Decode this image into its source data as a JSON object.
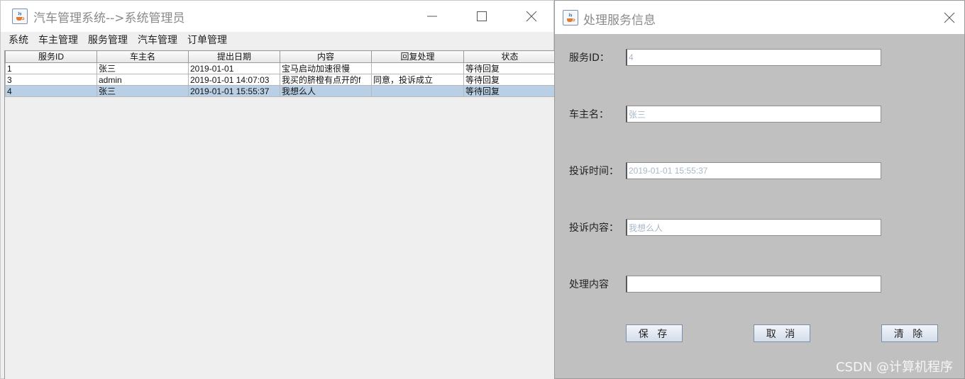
{
  "main_window": {
    "title": "汽车管理系统-->系统管理员",
    "menu": [
      "系统",
      "车主管理",
      "服务管理",
      "汽车管理",
      "订单管理"
    ],
    "table": {
      "columns": [
        "服务ID",
        "车主名",
        "提出日期",
        "内容",
        "回复处理",
        "状态"
      ],
      "rows": [
        [
          "1",
          "张三",
          "2019-01-01",
          "宝马启动加速很慢",
          "",
          "等待回复"
        ],
        [
          "3",
          "admin",
          "2019-01-01 14:07:03",
          "我买的脐橙有点开的f",
          "同意，投诉成立",
          "等待回复"
        ],
        [
          "4",
          "张三",
          "2019-01-01 15:55:37",
          "我想么人",
          "",
          "等待回复"
        ]
      ],
      "selected_row_index": 2
    }
  },
  "dialog": {
    "title": "处理服务信息",
    "fields": [
      {
        "label": "服务ID：",
        "value": "4"
      },
      {
        "label": "车主名：",
        "value": "张三"
      },
      {
        "label": "投诉时间：",
        "value": "2019-01-01 15:55:37"
      },
      {
        "label": "投诉内容：",
        "value": "我想么人"
      },
      {
        "label": "处理内容",
        "value": ""
      }
    ],
    "buttons": {
      "save": "保 存",
      "cancel": "取 消",
      "clear": "清 除"
    }
  },
  "watermark": "CSDN @计算机程序",
  "colors": {
    "selected_row": "#b8cfe5",
    "dialog_bg": "#c0c0c0",
    "disabled_text": "#a9b7c9"
  },
  "icons": {
    "app": "java-coffee-icon",
    "minimize": "minimize-icon",
    "maximize": "maximize-icon",
    "close": "close-icon"
  }
}
